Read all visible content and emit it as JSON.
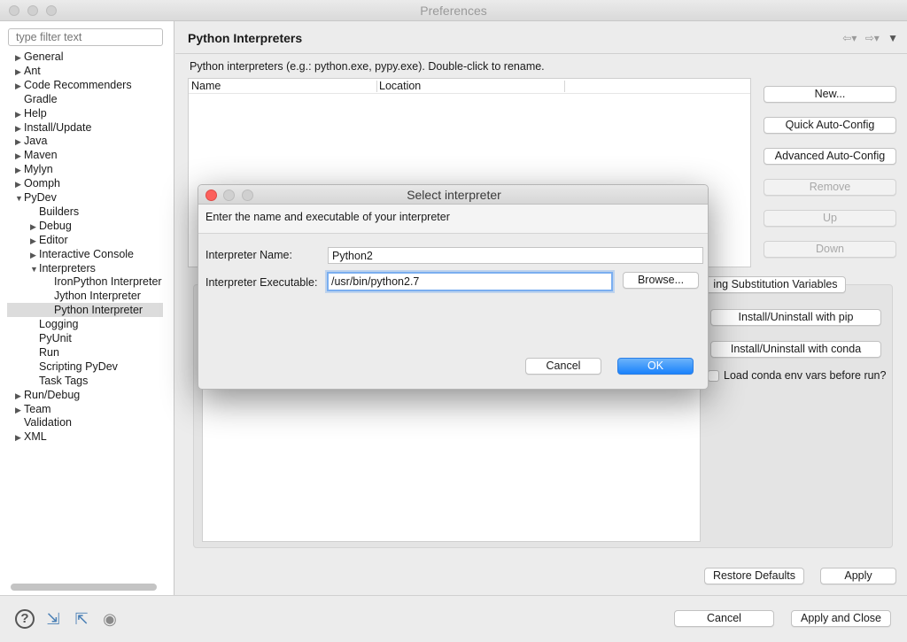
{
  "window": {
    "title": "Preferences"
  },
  "sidebar": {
    "filter_placeholder": "type filter text",
    "items": [
      {
        "label": "General",
        "level": 0,
        "expander": "▶"
      },
      {
        "label": "Ant",
        "level": 0,
        "expander": "▶"
      },
      {
        "label": "Code Recommenders",
        "level": 0,
        "expander": "▶"
      },
      {
        "label": "Gradle",
        "level": 0,
        "expander": ""
      },
      {
        "label": "Help",
        "level": 0,
        "expander": "▶"
      },
      {
        "label": "Install/Update",
        "level": 0,
        "expander": "▶"
      },
      {
        "label": "Java",
        "level": 0,
        "expander": "▶"
      },
      {
        "label": "Maven",
        "level": 0,
        "expander": "▶"
      },
      {
        "label": "Mylyn",
        "level": 0,
        "expander": "▶"
      },
      {
        "label": "Oomph",
        "level": 0,
        "expander": "▶"
      },
      {
        "label": "PyDev",
        "level": 0,
        "expander": "▼"
      },
      {
        "label": "Builders",
        "level": 1,
        "expander": ""
      },
      {
        "label": "Debug",
        "level": 1,
        "expander": "▶"
      },
      {
        "label": "Editor",
        "level": 1,
        "expander": "▶"
      },
      {
        "label": "Interactive Console",
        "level": 1,
        "expander": "▶"
      },
      {
        "label": "Interpreters",
        "level": 1,
        "expander": "▼"
      },
      {
        "label": "IronPython Interpreter",
        "level": 2,
        "expander": ""
      },
      {
        "label": "Jython Interpreter",
        "level": 2,
        "expander": ""
      },
      {
        "label": "Python Interpreter",
        "level": 2,
        "expander": "",
        "selected": true
      },
      {
        "label": "Logging",
        "level": 1,
        "expander": ""
      },
      {
        "label": "PyUnit",
        "level": 1,
        "expander": ""
      },
      {
        "label": "Run",
        "level": 1,
        "expander": ""
      },
      {
        "label": "Scripting PyDev",
        "level": 1,
        "expander": ""
      },
      {
        "label": "Task Tags",
        "level": 1,
        "expander": ""
      },
      {
        "label": "Run/Debug",
        "level": 0,
        "expander": "▶"
      },
      {
        "label": "Team",
        "level": 0,
        "expander": "▶"
      },
      {
        "label": "Validation",
        "level": 0,
        "expander": ""
      },
      {
        "label": "XML",
        "level": 0,
        "expander": "▶"
      }
    ]
  },
  "main": {
    "title": "Python Interpreters",
    "description": "Python interpreters (e.g.: python.exe, pypy.exe).   Double-click to rename.",
    "table_headers": {
      "name": "Name",
      "location": "Location"
    },
    "buttons": {
      "new": "New...",
      "quick": "Quick Auto-Config",
      "advanced": "Advanced Auto-Config",
      "remove": "Remove",
      "up": "Up",
      "down": "Down",
      "substitution": "ing Substitution Variables",
      "pip": "Install/Uninstall with pip",
      "conda": "Install/Uninstall with conda"
    },
    "conda_checkbox_label": "Load conda env vars before run?",
    "restore_defaults": "Restore Defaults",
    "apply": "Apply"
  },
  "footer": {
    "cancel": "Cancel",
    "apply_close": "Apply and Close"
  },
  "dialog": {
    "title": "Select interpreter",
    "message": "Enter the name and executable of your interpreter",
    "name_label": "Interpreter Name:",
    "name_value": "Python2",
    "exec_label": "Interpreter Executable:",
    "exec_value": "/usr/bin/python2.7",
    "browse": "Browse...",
    "cancel": "Cancel",
    "ok": "OK"
  },
  "colors": {
    "accent": "#1a82fb",
    "close": "#fc605c"
  }
}
